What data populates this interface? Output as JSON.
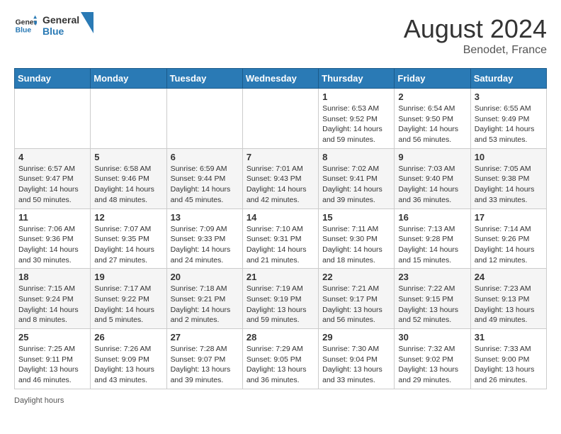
{
  "header": {
    "logo_line1": "General",
    "logo_line2": "Blue",
    "title": "August 2024",
    "subtitle": "Benodet, France"
  },
  "weekdays": [
    "Sunday",
    "Monday",
    "Tuesday",
    "Wednesday",
    "Thursday",
    "Friday",
    "Saturday"
  ],
  "weeks": [
    [
      {
        "day": "",
        "info": ""
      },
      {
        "day": "",
        "info": ""
      },
      {
        "day": "",
        "info": ""
      },
      {
        "day": "",
        "info": ""
      },
      {
        "day": "1",
        "info": "Sunrise: 6:53 AM\nSunset: 9:52 PM\nDaylight: 14 hours and 59 minutes."
      },
      {
        "day": "2",
        "info": "Sunrise: 6:54 AM\nSunset: 9:50 PM\nDaylight: 14 hours and 56 minutes."
      },
      {
        "day": "3",
        "info": "Sunrise: 6:55 AM\nSunset: 9:49 PM\nDaylight: 14 hours and 53 minutes."
      }
    ],
    [
      {
        "day": "4",
        "info": "Sunrise: 6:57 AM\nSunset: 9:47 PM\nDaylight: 14 hours and 50 minutes."
      },
      {
        "day": "5",
        "info": "Sunrise: 6:58 AM\nSunset: 9:46 PM\nDaylight: 14 hours and 48 minutes."
      },
      {
        "day": "6",
        "info": "Sunrise: 6:59 AM\nSunset: 9:44 PM\nDaylight: 14 hours and 45 minutes."
      },
      {
        "day": "7",
        "info": "Sunrise: 7:01 AM\nSunset: 9:43 PM\nDaylight: 14 hours and 42 minutes."
      },
      {
        "day": "8",
        "info": "Sunrise: 7:02 AM\nSunset: 9:41 PM\nDaylight: 14 hours and 39 minutes."
      },
      {
        "day": "9",
        "info": "Sunrise: 7:03 AM\nSunset: 9:40 PM\nDaylight: 14 hours and 36 minutes."
      },
      {
        "day": "10",
        "info": "Sunrise: 7:05 AM\nSunset: 9:38 PM\nDaylight: 14 hours and 33 minutes."
      }
    ],
    [
      {
        "day": "11",
        "info": "Sunrise: 7:06 AM\nSunset: 9:36 PM\nDaylight: 14 hours and 30 minutes."
      },
      {
        "day": "12",
        "info": "Sunrise: 7:07 AM\nSunset: 9:35 PM\nDaylight: 14 hours and 27 minutes."
      },
      {
        "day": "13",
        "info": "Sunrise: 7:09 AM\nSunset: 9:33 PM\nDaylight: 14 hours and 24 minutes."
      },
      {
        "day": "14",
        "info": "Sunrise: 7:10 AM\nSunset: 9:31 PM\nDaylight: 14 hours and 21 minutes."
      },
      {
        "day": "15",
        "info": "Sunrise: 7:11 AM\nSunset: 9:30 PM\nDaylight: 14 hours and 18 minutes."
      },
      {
        "day": "16",
        "info": "Sunrise: 7:13 AM\nSunset: 9:28 PM\nDaylight: 14 hours and 15 minutes."
      },
      {
        "day": "17",
        "info": "Sunrise: 7:14 AM\nSunset: 9:26 PM\nDaylight: 14 hours and 12 minutes."
      }
    ],
    [
      {
        "day": "18",
        "info": "Sunrise: 7:15 AM\nSunset: 9:24 PM\nDaylight: 14 hours and 8 minutes."
      },
      {
        "day": "19",
        "info": "Sunrise: 7:17 AM\nSunset: 9:22 PM\nDaylight: 14 hours and 5 minutes."
      },
      {
        "day": "20",
        "info": "Sunrise: 7:18 AM\nSunset: 9:21 PM\nDaylight: 14 hours and 2 minutes."
      },
      {
        "day": "21",
        "info": "Sunrise: 7:19 AM\nSunset: 9:19 PM\nDaylight: 13 hours and 59 minutes."
      },
      {
        "day": "22",
        "info": "Sunrise: 7:21 AM\nSunset: 9:17 PM\nDaylight: 13 hours and 56 minutes."
      },
      {
        "day": "23",
        "info": "Sunrise: 7:22 AM\nSunset: 9:15 PM\nDaylight: 13 hours and 52 minutes."
      },
      {
        "day": "24",
        "info": "Sunrise: 7:23 AM\nSunset: 9:13 PM\nDaylight: 13 hours and 49 minutes."
      }
    ],
    [
      {
        "day": "25",
        "info": "Sunrise: 7:25 AM\nSunset: 9:11 PM\nDaylight: 13 hours and 46 minutes."
      },
      {
        "day": "26",
        "info": "Sunrise: 7:26 AM\nSunset: 9:09 PM\nDaylight: 13 hours and 43 minutes."
      },
      {
        "day": "27",
        "info": "Sunrise: 7:28 AM\nSunset: 9:07 PM\nDaylight: 13 hours and 39 minutes."
      },
      {
        "day": "28",
        "info": "Sunrise: 7:29 AM\nSunset: 9:05 PM\nDaylight: 13 hours and 36 minutes."
      },
      {
        "day": "29",
        "info": "Sunrise: 7:30 AM\nSunset: 9:04 PM\nDaylight: 13 hours and 33 minutes."
      },
      {
        "day": "30",
        "info": "Sunrise: 7:32 AM\nSunset: 9:02 PM\nDaylight: 13 hours and 29 minutes."
      },
      {
        "day": "31",
        "info": "Sunrise: 7:33 AM\nSunset: 9:00 PM\nDaylight: 13 hours and 26 minutes."
      }
    ]
  ],
  "footer": {
    "note": "Daylight hours"
  }
}
